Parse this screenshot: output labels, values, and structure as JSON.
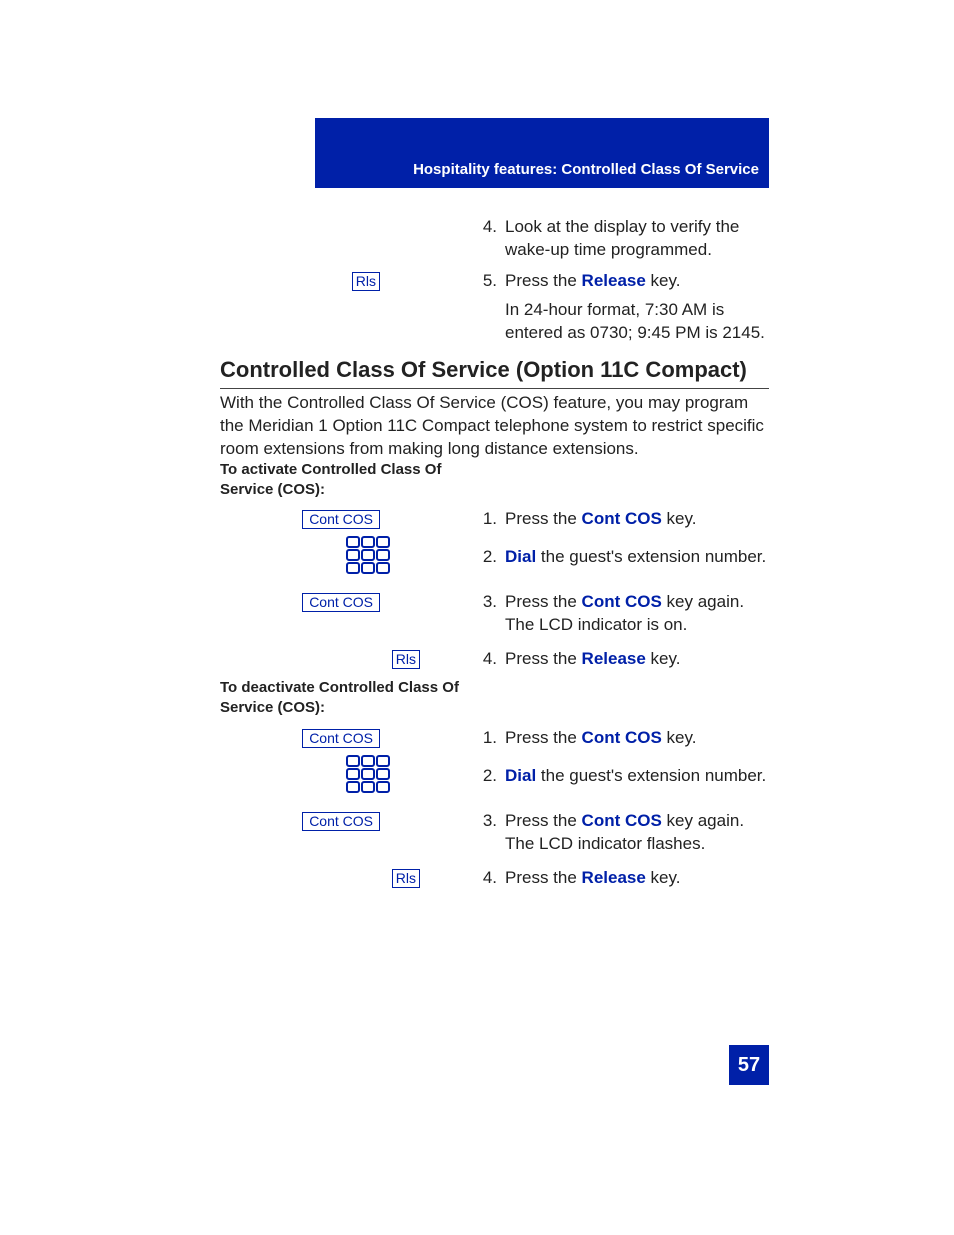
{
  "header": {
    "caption": "Hospitality features: Controlled Class Of Service"
  },
  "top_steps": {
    "step4": {
      "n": "4.",
      "text": "Look at the display to verify the wake-up time programmed."
    },
    "step5": {
      "n": "5.",
      "prefix": "Press the ",
      "key": "Release",
      "suffix": " key."
    },
    "note": "In 24-hour format, 7:30 AM is entered as 0730; 9:45 PM is 2145."
  },
  "keys": {
    "rls": "Rls",
    "cont_cos": "Cont COS"
  },
  "section": {
    "heading": "Controlled Class Of Service (Option 11C Compact)",
    "intro": "With the Controlled Class Of Service (COS) feature, you may program the Meridian 1 Option 11C Compact telephone system to restrict specific room extensions from making long distance extensions."
  },
  "activate": {
    "title": "To activate Controlled Class Of Service (COS):",
    "s1": {
      "n": "1.",
      "prefix": "Press the ",
      "key": "Cont COS",
      "suffix": " key."
    },
    "s2": {
      "n": "2.",
      "key": "Dial",
      "suffix": " the guest's extension number."
    },
    "s3": {
      "n": "3.",
      "prefix": "Press the ",
      "key": "Cont COS",
      "suffix": " key again. The LCD indicator is on."
    },
    "s4": {
      "n": "4.",
      "prefix": "Press the ",
      "key": "Release",
      "suffix": " key."
    }
  },
  "deactivate": {
    "title": "To deactivate Controlled Class Of Service (COS):",
    "s1": {
      "n": "1.",
      "prefix": "Press the ",
      "key": "Cont COS",
      "suffix": " key."
    },
    "s2": {
      "n": "2.",
      "key": "Dial",
      "suffix": " the guest's extension number."
    },
    "s3": {
      "n": "3.",
      "prefix": "Press the ",
      "key": "Cont COS",
      "suffix": " key again. The LCD indicator flashes."
    },
    "s4": {
      "n": "4.",
      "prefix": "Press the ",
      "key": "Release",
      "suffix": " key."
    }
  },
  "page_number": "57"
}
